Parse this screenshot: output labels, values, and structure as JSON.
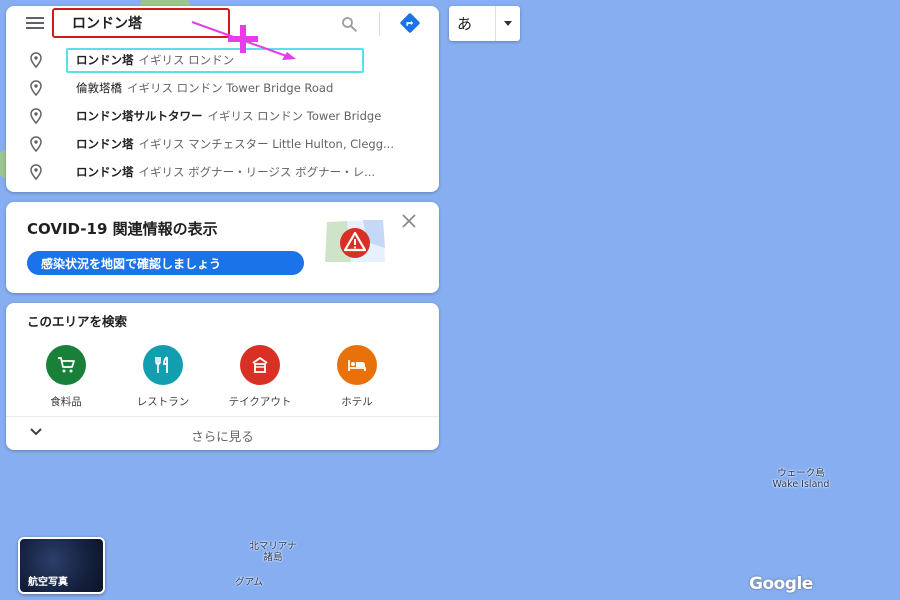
{
  "search": {
    "value": "ロンドン塔",
    "menu_icon": "hamburger-menu-icon",
    "search_icon": "search-icon",
    "directions_icon": "directions-icon"
  },
  "suggestions": [
    {
      "main": "ロンドン塔",
      "sub": "イギリス ロンドン"
    },
    {
      "main": "倫敦塔橋",
      "sub": "イギリス ロンドン Tower Bridge Road"
    },
    {
      "main": "ロンドン塔サルトタワー",
      "sub": "イギリス ロンドン Tower Bridge"
    },
    {
      "main": "ロンドン塔",
      "sub": "イギリス マンチェスター Little Hulton, Clegg..."
    },
    {
      "main": "ロンドン塔",
      "sub": "イギリス ボグナー・リージス ボグナー・レ..."
    }
  ],
  "ime": {
    "label": "あ"
  },
  "covid": {
    "title": "COVID-19 関連情報の表示",
    "button": "感染状況を地図で確認しましょう"
  },
  "explore": {
    "title": "このエリアを検索",
    "categories": [
      {
        "label": "食料品",
        "icon": "cart-icon",
        "color": "#188038"
      },
      {
        "label": "レストラン",
        "icon": "restaurant-icon",
        "color": "#129eaf"
      },
      {
        "label": "テイクアウト",
        "icon": "takeout-icon",
        "color": "#d93025"
      },
      {
        "label": "ホテル",
        "icon": "hotel-icon",
        "color": "#e8710a"
      }
    ],
    "more": "さらに見る"
  },
  "map": {
    "labels": {
      "wake_jp": "ウェーク島",
      "wake_en": "Wake Island",
      "marianas_1": "北マリアナ",
      "marianas_2": "諸島",
      "guam": "グアム"
    },
    "satellite_label": "航空写真",
    "logo": "Google"
  },
  "colors": {
    "map_water": "#86aef0",
    "accent_blue": "#1a73e8",
    "highlight_red": "#d41818",
    "highlight_cyan": "#5be0e8",
    "annotation_magenta": "#e83ce8"
  }
}
